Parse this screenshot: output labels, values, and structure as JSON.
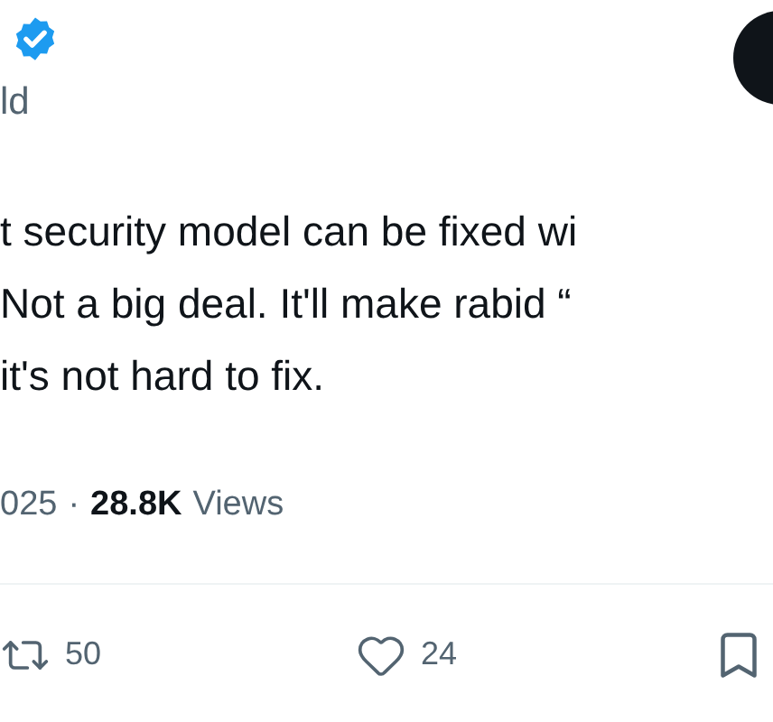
{
  "author": {
    "handle": "ld",
    "verified": true
  },
  "tweet": {
    "lines": [
      "t security model can be fixed wi",
      "Not a big deal. It'll make rabid “",
      "it's not hard to fix."
    ]
  },
  "meta": {
    "date": "025",
    "separator": "·",
    "views_count": "28.8K",
    "views_label": "Views"
  },
  "actions": [
    {
      "kind": "retweet",
      "count": "50"
    },
    {
      "kind": "like",
      "count": "24"
    },
    {
      "kind": "bookmark"
    }
  ]
}
